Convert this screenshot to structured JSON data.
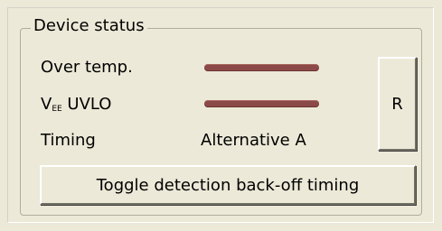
{
  "group": {
    "title": "Device status"
  },
  "rows": {
    "over_temp": {
      "label": "Over temp.",
      "indicator_color": "#8b4a47"
    },
    "vee_uvlo": {
      "label_prefix": "V",
      "label_sub": "EE",
      "label_suffix": " UVLO",
      "indicator_color": "#8b4a47"
    },
    "timing": {
      "label": "Timing",
      "value": "Alternative A"
    }
  },
  "buttons": {
    "reset_label": "R",
    "toggle_label": "Toggle detection back-off timing"
  }
}
